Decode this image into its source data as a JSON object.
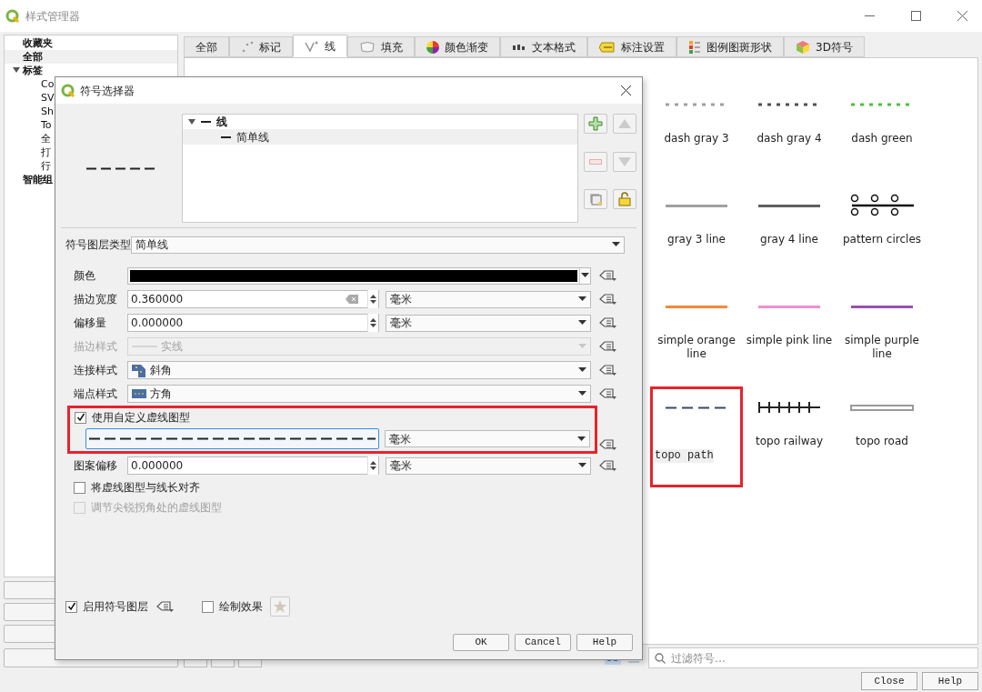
{
  "window": {
    "title": "样式管理器"
  },
  "sidebar": {
    "items": [
      {
        "label": "收藏夹",
        "selected": false
      },
      {
        "label": "全部",
        "selected": true
      },
      {
        "label": "标签",
        "selected": false,
        "expanded": true,
        "children": [
          {
            "label": "Co",
            "selected": false
          },
          {
            "label": "SV",
            "selected": false
          },
          {
            "label": "Sh",
            "selected": false
          },
          {
            "label": "To",
            "selected": false
          },
          {
            "label": "全",
            "selected": false
          },
          {
            "label": "打",
            "selected": false
          },
          {
            "label": "行",
            "selected": false
          }
        ]
      },
      {
        "label": "智能组",
        "selected": false
      }
    ]
  },
  "tabs": [
    {
      "label": "全部",
      "kind": "all",
      "selected": false
    },
    {
      "label": "标记",
      "kind": "marker",
      "selected": false
    },
    {
      "label": "线",
      "kind": "line",
      "selected": true
    },
    {
      "label": "填充",
      "kind": "fill",
      "selected": false
    },
    {
      "label": "颜色渐变",
      "kind": "ramp",
      "selected": false
    },
    {
      "label": "文本格式",
      "kind": "text",
      "selected": false
    },
    {
      "label": "标注设置",
      "kind": "label",
      "selected": false
    },
    {
      "label": "图例图斑形状",
      "kind": "legend",
      "selected": false
    },
    {
      "label": "3D符号",
      "kind": "cube",
      "selected": false
    }
  ],
  "symbols": [
    {
      "name": "dash gray 3",
      "kind": "dash",
      "color": "#a0a0a0",
      "selected": false,
      "highlighted": false
    },
    {
      "name": "dash gray 4",
      "kind": "dash",
      "color": "#505050",
      "selected": false,
      "highlighted": false
    },
    {
      "name": "dash green",
      "kind": "dash",
      "color": "#4cbf3c",
      "selected": false,
      "highlighted": false
    },
    {
      "name": "gray 3 line",
      "kind": "solid",
      "color": "#a0a0a0",
      "selected": false,
      "highlighted": false
    },
    {
      "name": "gray 4 line",
      "kind": "solid",
      "color": "#606060",
      "selected": false,
      "highlighted": false
    },
    {
      "name": "pattern circles",
      "kind": "circles",
      "color": "#111111",
      "selected": false,
      "highlighted": false
    },
    {
      "name": "simple orange line",
      "kind": "solid",
      "color": "#f7883a",
      "selected": false,
      "highlighted": false
    },
    {
      "name": "simple pink line",
      "kind": "solid",
      "color": "#f48cce",
      "selected": false,
      "highlighted": false
    },
    {
      "name": "simple purple line",
      "kind": "solid",
      "color": "#9a50b0",
      "selected": false,
      "highlighted": false
    },
    {
      "name": "topo path",
      "kind": "longdash",
      "color": "#3a4a5e",
      "selected": true,
      "highlighted": true
    },
    {
      "name": "topo railway",
      "kind": "railway",
      "color": "#222222",
      "selected": false,
      "highlighted": false
    },
    {
      "name": "topo road",
      "kind": "road",
      "color": "#999999",
      "selected": false,
      "highlighted": false
    }
  ],
  "filter": {
    "placeholder": "过滤符号…"
  },
  "buttons": [
    "Close",
    "Help"
  ],
  "symbol_selector": {
    "title": "符号选择器",
    "tree": [
      {
        "label": "线",
        "expanded": true,
        "selected": false,
        "children": [
          {
            "label": "简单线",
            "selected": true
          }
        ]
      }
    ],
    "layer_type": {
      "label": "符号图层类型",
      "value": "简单线"
    },
    "fields": [
      {
        "kind": "color",
        "label": "颜色",
        "color": "#000000",
        "disabled": false
      },
      {
        "kind": "spin",
        "label": "描边宽度",
        "value": "0.360000",
        "unit": "毫米",
        "clearable": true,
        "disabled": false
      },
      {
        "kind": "spin",
        "label": "偏移量",
        "value": "0.000000",
        "unit": "毫米",
        "clearable": false,
        "disabled": false
      },
      {
        "kind": "pen",
        "label": "描边样式",
        "value": "实线",
        "disabled": true
      },
      {
        "kind": "join",
        "label": "连接样式",
        "value": "斜角",
        "disabled": false
      },
      {
        "kind": "cap",
        "label": "端点样式",
        "value": "方角",
        "disabled": false
      },
      {
        "kind": "custom_dash",
        "label": "使用自定义虚线图型",
        "checked": true,
        "unit": "毫米",
        "highlighted": true,
        "disabled": false
      },
      {
        "kind": "spin",
        "label": "图案偏移",
        "value": "0.000000",
        "unit": "毫米",
        "clearable": false,
        "disabled": false
      },
      {
        "kind": "checkbox",
        "label": "将虚线图型与线长对齐",
        "checked": false,
        "disabled": false
      },
      {
        "kind": "checkbox",
        "label": "调节尖锐拐角处的虚线图型",
        "checked": false,
        "disabled": true
      }
    ],
    "enable_layer": {
      "label": "启用符号图层",
      "checked": true
    },
    "draw_effects": {
      "label": "绘制效果",
      "checked": false
    },
    "buttons": [
      "OK",
      "Cancel",
      "Help"
    ]
  }
}
